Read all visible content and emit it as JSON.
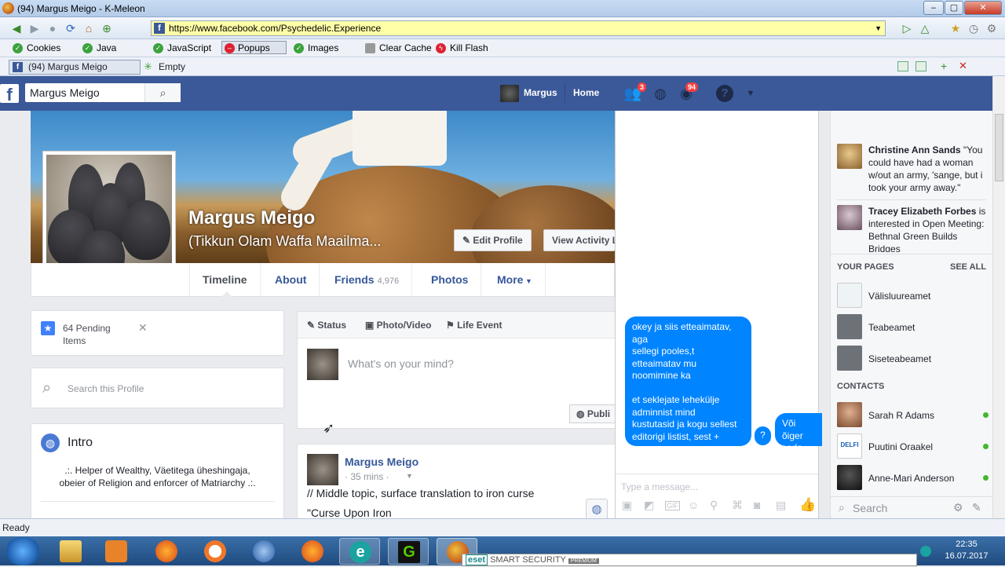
{
  "window": {
    "title": "(94) Margus Meigo - K-Meleon"
  },
  "browser": {
    "url": "https://www.facebook.com/Psychedelic.Experience",
    "toolbar": [
      "Cookies",
      "Java",
      "JavaScript",
      "Popups",
      "Images",
      "Clear Cache",
      "Kill Flash"
    ],
    "tab": "(94) Margus Meigo",
    "empty": "Empty",
    "status": "Ready"
  },
  "fb": {
    "search": "Margus Meigo",
    "user": "Margus",
    "home": "Home",
    "friend_badge": "3",
    "notif_badge": "94"
  },
  "profile": {
    "name": "Margus Meigo",
    "alt": "(Tikkun Olam Waffa Maailma...",
    "edit": "Edit Profile",
    "activity": "View Activity L",
    "tabs": {
      "timeline": "Timeline",
      "about": "About",
      "friends": "Friends",
      "friends_count": "4,976",
      "photos": "Photos",
      "more": "More"
    }
  },
  "left": {
    "pending": "64 Pending Items",
    "search_placeholder": "Search this Profile",
    "intro": "Intro",
    "intro_text": ".:. Helper of Wealthy, Väetitega üheshingaja, obeier of Religion and enforcer of Matriarchy .:."
  },
  "composer": {
    "status": "Status",
    "photo": "Photo/Video",
    "life": "Life Event",
    "placeholder": "What's on your mind?",
    "publish": "Publi"
  },
  "post": {
    "author": "Margus Meigo",
    "time": "· 35 mins ·",
    "line1": "// Middle topic, surface translation to iron curse",
    "line2": "\"Curse Upon Iron"
  },
  "chat": {
    "msg1": "okey ja siis etteaimatav,\naga\nsellegi pooles,t\netteaimatav mu\nnoomimine ka\n\net seklejate lehekülje\nadminnist mind\nkustutasid ja kogu sellest\neditorigi listist, sest +",
    "msg2": "?",
    "msg3": "Või õiger\nseda ise",
    "placeholder": "Type a message..."
  },
  "sidebar": {
    "ticker": [
      {
        "name": "Christine Ann Sands",
        "text": " \"You could have had a woman w/out an army, 'sange, but i took your army away.\""
      },
      {
        "name": "Tracey Elizabeth Forbes",
        "text": " is interested in Open Meeting: Bethnal Green Builds Bridges"
      }
    ],
    "your_pages": "YOUR PAGES",
    "see_all": "SEE ALL",
    "pages": [
      "Välisluureamet",
      "Teabeamet",
      "Siseteabeamet"
    ],
    "contacts": "CONTACTS",
    "contact_list": [
      "Sarah R Adams",
      "Puutini Oraakel",
      "Anne-Mari Anderson"
    ],
    "search": "Search"
  },
  "taskbar": {
    "time": "22:35",
    "date": "16.07.2017",
    "eset": "SMART SECURITY",
    "eset_brand": "eset",
    "eset_tag": "PREMIUM"
  },
  "colors": {
    "fb_blue": "#3b5998",
    "messenger_blue": "#0084ff",
    "online": "#42b72a"
  }
}
